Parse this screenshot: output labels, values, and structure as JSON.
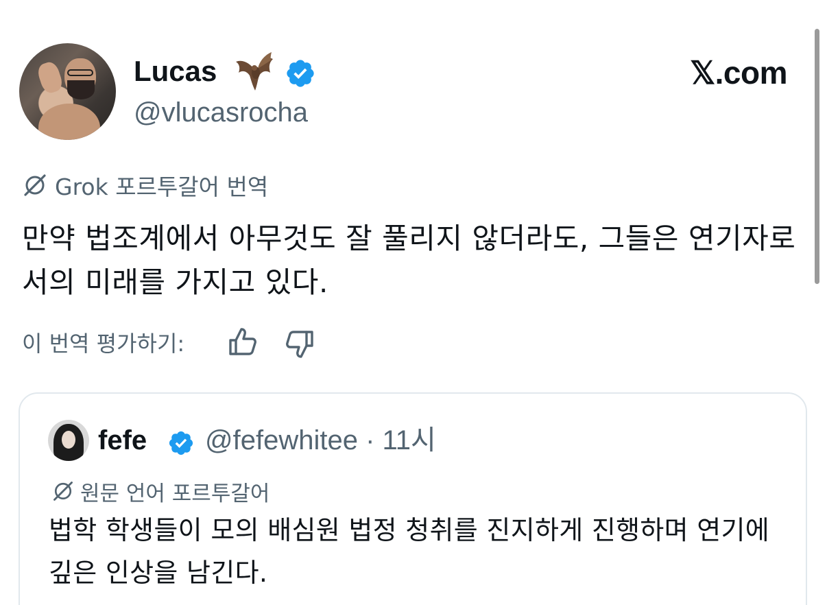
{
  "tweet": {
    "author_name": "Lucas",
    "author_handle": "@vlucasrocha",
    "name_emoji": "bat-icon",
    "verified": true,
    "brand": "𝕏.com",
    "translation_label": "Grok 포르투갈어 번역",
    "text": "만약 법조계에서 아무것도 잘 풀리지 않더라도, 그들은 연기자로서의 미래를 가지고 있다.",
    "rate_label": "이 번역 평가하기:"
  },
  "quoted": {
    "author_name": "fefe",
    "author_handle": "@fefewhitee",
    "separator": "·",
    "time": "11시",
    "verified": true,
    "language_label": "원문 언어 포르투갈어",
    "text": "법학 학생들이 모의 배심원 법정 청취를 진지하게 진행하며 연기에 깊은 인상을 남긴다."
  },
  "colors": {
    "text_primary": "#0f1419",
    "text_secondary": "#536471",
    "verified_blue": "#1d9bf0",
    "card_border": "#e1e8ed"
  }
}
